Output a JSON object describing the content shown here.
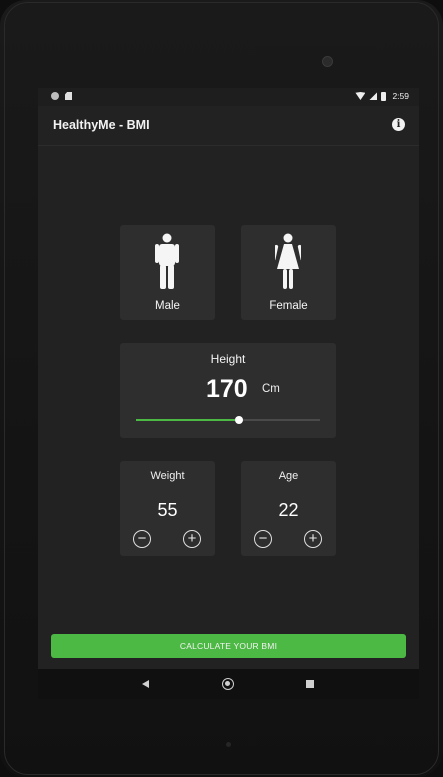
{
  "status_bar": {
    "time": "2:59",
    "icons": [
      "notification-dot-icon",
      "sd-card-icon",
      "wifi-icon",
      "signal-icon",
      "battery-icon"
    ]
  },
  "app_bar": {
    "title": "HealthyMe - BMI",
    "info_icon": "i"
  },
  "gender": {
    "male_label": "Male",
    "female_label": "Female"
  },
  "height": {
    "title": "Height",
    "value": "170",
    "unit": "Cm",
    "slider_fraction": 0.56
  },
  "weight": {
    "title": "Weight",
    "value": "55",
    "minus": "−",
    "plus": "+"
  },
  "age": {
    "title": "Age",
    "value": "22",
    "minus": "−",
    "plus": "+"
  },
  "calculate_button": {
    "label": "CALCULATE YOUR BMI"
  },
  "colors": {
    "accent": "#4cb944",
    "card": "#2e2e2e",
    "background": "#222222"
  },
  "nav": {
    "icons": [
      "back-icon",
      "home-icon",
      "recents-icon"
    ]
  }
}
